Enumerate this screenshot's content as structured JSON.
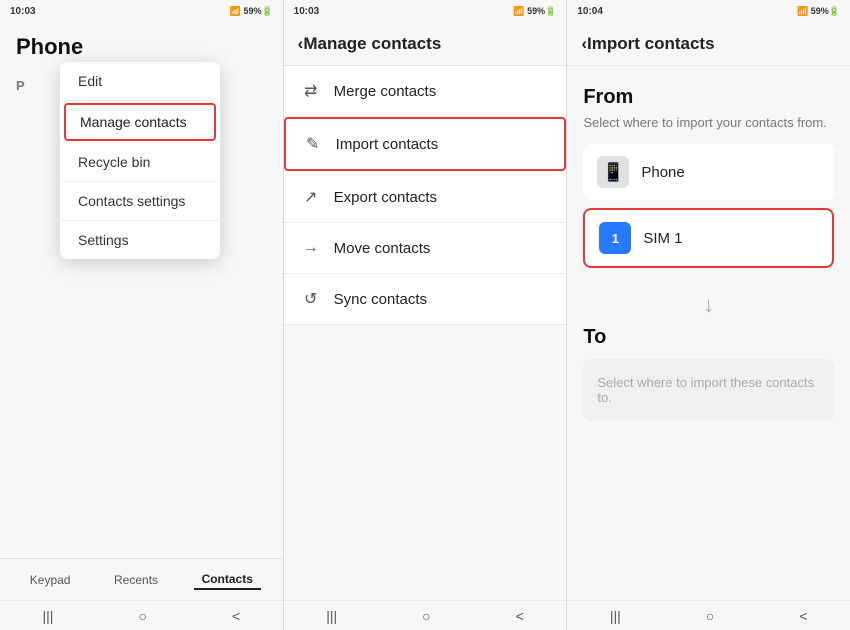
{
  "screens": [
    {
      "id": "phone",
      "statusBar": {
        "time": "10:03",
        "rightIcons": "📶 59%🔋"
      },
      "title": "Phone",
      "dropdown": {
        "items": [
          "Edit",
          "Manage contacts",
          "Recycle bin",
          "Contacts settings",
          "Settings"
        ],
        "activeIndex": 1
      },
      "contactLetter": "P",
      "bottomTabs": [
        "Keypad",
        "Recents",
        "Contacts"
      ],
      "activeTab": 2,
      "systemNav": [
        "|||",
        "○",
        "<"
      ]
    },
    {
      "id": "manage-contacts",
      "statusBar": {
        "time": "10:03",
        "rightIcons": "📶 59%🔋"
      },
      "backLabel": "‹",
      "title": "Manage contacts",
      "items": [
        {
          "icon": "⇄",
          "label": "Merge contacts",
          "highlighted": false
        },
        {
          "icon": "✎",
          "label": "Import contacts",
          "highlighted": true
        },
        {
          "icon": "↗",
          "label": "Export contacts",
          "highlighted": false
        },
        {
          "icon": "→",
          "label": "Move contacts",
          "highlighted": false
        },
        {
          "icon": "↺",
          "label": "Sync contacts",
          "highlighted": false
        }
      ],
      "systemNav": [
        "|||",
        "○",
        "<"
      ]
    },
    {
      "id": "import-contacts",
      "statusBar": {
        "time": "10:04",
        "rightIcons": "📶 59%🔋"
      },
      "backLabel": "‹",
      "title": "Import contacts",
      "fromLabel": "From",
      "fromDesc": "Select where to import your contacts from.",
      "fromOptions": [
        {
          "type": "phone",
          "label": "Phone",
          "selected": false
        },
        {
          "type": "sim",
          "label": "SIM 1",
          "simNumber": "1",
          "selected": true
        }
      ],
      "arrowDown": "↓",
      "toLabel": "To",
      "toPlaceholder": "Select where to import these contacts to.",
      "systemNav": [
        "|||",
        "○",
        "<"
      ]
    }
  ]
}
